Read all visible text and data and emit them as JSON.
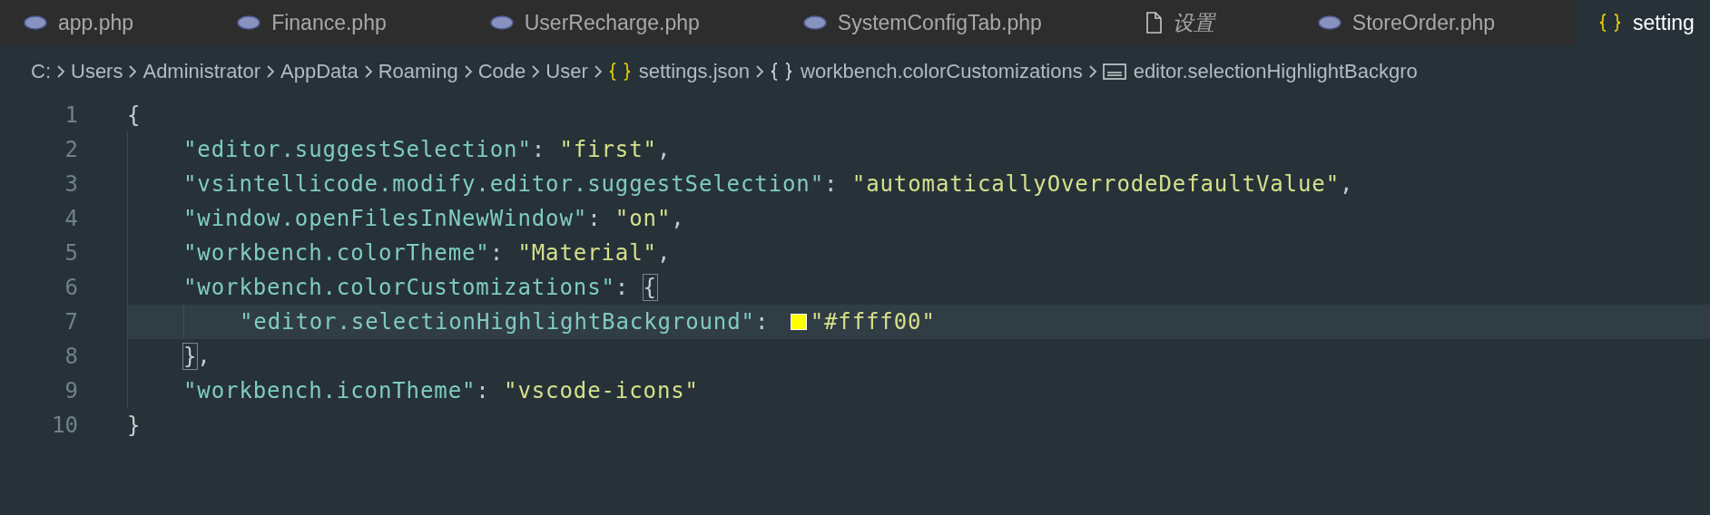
{
  "tabs": [
    {
      "label": "app.php",
      "kind": "php",
      "selected": false,
      "preview": false
    },
    {
      "label": "Finance.php",
      "kind": "php",
      "selected": false,
      "preview": false
    },
    {
      "label": "UserRecharge.php",
      "kind": "php",
      "selected": false,
      "preview": false
    },
    {
      "label": "SystemConfigTab.php",
      "kind": "php",
      "selected": false,
      "preview": false
    },
    {
      "label": "设置",
      "kind": "file",
      "selected": false,
      "preview": true
    },
    {
      "label": "StoreOrder.php",
      "kind": "php",
      "selected": false,
      "preview": false
    },
    {
      "label": "setting",
      "kind": "json",
      "selected": true,
      "preview": false
    }
  ],
  "breadcrumb": [
    {
      "label": "C:",
      "kind": "folder"
    },
    {
      "label": "Users",
      "kind": "folder"
    },
    {
      "label": "Administrator",
      "kind": "folder"
    },
    {
      "label": "AppData",
      "kind": "folder"
    },
    {
      "label": "Roaming",
      "kind": "folder"
    },
    {
      "label": "Code",
      "kind": "folder"
    },
    {
      "label": "User",
      "kind": "folder"
    },
    {
      "label": "settings.json",
      "kind": "json"
    },
    {
      "label": "workbench.colorCustomizations",
      "kind": "object"
    },
    {
      "label": "editor.selectionHighlightBackgro",
      "kind": "string"
    }
  ],
  "lines": [
    {
      "number": "1",
      "current": false,
      "tokens": [
        {
          "kind": "punct",
          "text": "{"
        }
      ]
    },
    {
      "number": "2",
      "current": false,
      "tokens": [
        {
          "kind": "indent"
        },
        {
          "kind": "key",
          "text": "\"editor.suggestSelection\""
        },
        {
          "kind": "punct",
          "text": ": "
        },
        {
          "kind": "string",
          "text": "\"first\""
        },
        {
          "kind": "punct",
          "text": ","
        }
      ]
    },
    {
      "number": "3",
      "current": false,
      "tokens": [
        {
          "kind": "indent"
        },
        {
          "kind": "key",
          "text": "\"vsintellicode.modify.editor.suggestSelection\""
        },
        {
          "kind": "punct",
          "text": ": "
        },
        {
          "kind": "string",
          "text": "\"automaticallyOverrodeDefaultValue\""
        },
        {
          "kind": "punct",
          "text": ","
        }
      ]
    },
    {
      "number": "4",
      "current": false,
      "tokens": [
        {
          "kind": "indent"
        },
        {
          "kind": "key",
          "text": "\"window.openFilesInNewWindow\""
        },
        {
          "kind": "punct",
          "text": ": "
        },
        {
          "kind": "string",
          "text": "\"on\""
        },
        {
          "kind": "punct",
          "text": ","
        }
      ]
    },
    {
      "number": "5",
      "current": false,
      "tokens": [
        {
          "kind": "indent"
        },
        {
          "kind": "key",
          "text": "\"workbench.colorTheme\""
        },
        {
          "kind": "punct",
          "text": ": "
        },
        {
          "kind": "string",
          "text": "\"Material\""
        },
        {
          "kind": "punct",
          "text": ","
        }
      ]
    },
    {
      "number": "6",
      "current": false,
      "tokens": [
        {
          "kind": "indent"
        },
        {
          "kind": "key",
          "text": "\"workbench.colorCustomizations\""
        },
        {
          "kind": "punct",
          "text": ": "
        },
        {
          "kind": "bracket",
          "text": "{"
        }
      ]
    },
    {
      "number": "7",
      "current": true,
      "tokens": [
        {
          "kind": "indent"
        },
        {
          "kind": "indent"
        },
        {
          "kind": "key",
          "text": "\"editor.selectionHighlightBackground\""
        },
        {
          "kind": "punct",
          "text": ": "
        },
        {
          "kind": "swatch",
          "color": "#ffff00"
        },
        {
          "kind": "string",
          "text": "\"#ffff00\""
        }
      ]
    },
    {
      "number": "8",
      "current": false,
      "tokens": [
        {
          "kind": "indent"
        },
        {
          "kind": "bracket",
          "text": "}"
        },
        {
          "kind": "punct",
          "text": ","
        }
      ]
    },
    {
      "number": "9",
      "current": false,
      "tokens": [
        {
          "kind": "indent"
        },
        {
          "kind": "key",
          "text": "\"workbench.iconTheme\""
        },
        {
          "kind": "punct",
          "text": ": "
        },
        {
          "kind": "string",
          "text": "\"vscode-icons\""
        }
      ]
    },
    {
      "number": "10",
      "current": false,
      "tokens": [
        {
          "kind": "punct",
          "text": "}"
        }
      ]
    }
  ]
}
